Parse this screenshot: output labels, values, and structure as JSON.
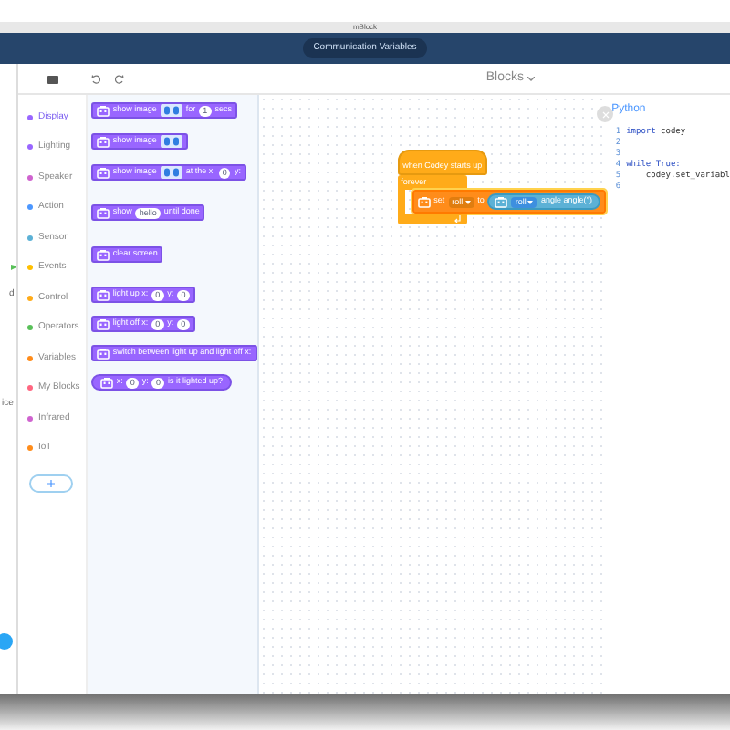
{
  "window": {
    "title": "mBlock",
    "tab": "Communication Variables"
  },
  "left_panel": {
    "texts": [
      "d",
      "ice"
    ]
  },
  "toolbar": {
    "mode": "Blocks"
  },
  "categories": [
    {
      "label": "Display",
      "color": "#9966ff",
      "selected": true
    },
    {
      "label": "Lighting",
      "color": "#9966ff",
      "selected": false
    },
    {
      "label": "Speaker",
      "color": "#cf63cf",
      "selected": false
    },
    {
      "label": "Action",
      "color": "#4c97ff",
      "selected": false
    },
    {
      "label": "Sensor",
      "color": "#5cb1d6",
      "selected": false
    },
    {
      "label": "Events",
      "color": "#ffbf00",
      "selected": false
    },
    {
      "label": "Control",
      "color": "#ffab19",
      "selected": false
    },
    {
      "label": "Operators",
      "color": "#59c059",
      "selected": false
    },
    {
      "label": "Variables",
      "color": "#ff8c1a",
      "selected": false
    },
    {
      "label": "My Blocks",
      "color": "#ff6680",
      "selected": false
    },
    {
      "label": "Infrared",
      "color": "#cf63cf",
      "selected": false
    },
    {
      "label": "IoT",
      "color": "#ff8c1a",
      "selected": false
    }
  ],
  "palette": [
    {
      "kind": "stack",
      "parts": [
        {
          "kind": "icon"
        },
        {
          "kind": "text",
          "text": "show image"
        },
        {
          "kind": "face"
        },
        {
          "kind": "text",
          "text": "for"
        },
        {
          "kind": "input",
          "text": "1"
        },
        {
          "kind": "text",
          "text": "secs"
        }
      ]
    },
    {
      "kind": "stack",
      "parts": [
        {
          "kind": "icon"
        },
        {
          "kind": "text",
          "text": "show image"
        },
        {
          "kind": "face"
        }
      ]
    },
    {
      "kind": "stack",
      "parts": [
        {
          "kind": "icon"
        },
        {
          "kind": "text",
          "text": "show image"
        },
        {
          "kind": "face"
        },
        {
          "kind": "text",
          "text": "at the x:"
        },
        {
          "kind": "input",
          "text": "0"
        },
        {
          "kind": "text",
          "text": "y:"
        }
      ]
    },
    {
      "kind": "stack",
      "parts": [
        {
          "kind": "icon"
        },
        {
          "kind": "text",
          "text": "show"
        },
        {
          "kind": "input",
          "text": "hello"
        },
        {
          "kind": "text",
          "text": "until done"
        }
      ]
    },
    {
      "kind": "stack",
      "parts": [
        {
          "kind": "icon"
        },
        {
          "kind": "text",
          "text": "clear screen"
        }
      ]
    },
    {
      "kind": "stack",
      "parts": [
        {
          "kind": "icon"
        },
        {
          "kind": "text",
          "text": "light up x:"
        },
        {
          "kind": "input",
          "text": "0"
        },
        {
          "kind": "text",
          "text": "y:"
        },
        {
          "kind": "input",
          "text": "0"
        }
      ]
    },
    {
      "kind": "stack",
      "parts": [
        {
          "kind": "icon"
        },
        {
          "kind": "text",
          "text": "light off x:"
        },
        {
          "kind": "input",
          "text": "0"
        },
        {
          "kind": "text",
          "text": "y:"
        },
        {
          "kind": "input",
          "text": "0"
        }
      ]
    },
    {
      "kind": "stack",
      "parts": [
        {
          "kind": "icon"
        },
        {
          "kind": "text",
          "text": "switch between light up and light off x:"
        }
      ]
    },
    {
      "kind": "boolean",
      "parts": [
        {
          "kind": "icon"
        },
        {
          "kind": "text",
          "text": "x:"
        },
        {
          "kind": "input",
          "text": "0"
        },
        {
          "kind": "text",
          "text": "y:"
        },
        {
          "kind": "input",
          "text": "0"
        },
        {
          "kind": "text",
          "text": "is it lighted up?"
        }
      ]
    }
  ],
  "script": {
    "hat": "when Codey starts up",
    "loop": "forever",
    "statement": [
      {
        "kind": "icon"
      },
      {
        "kind": "text",
        "text": "set"
      },
      {
        "kind": "dropdown",
        "text": "roll"
      },
      {
        "kind": "text",
        "text": "to"
      },
      {
        "kind": "reporter",
        "parts": [
          {
            "kind": "icon"
          },
          {
            "kind": "dropdown",
            "text": "roll"
          },
          {
            "kind": "text",
            "text": "angle angle(°)"
          }
        ]
      }
    ]
  },
  "python": {
    "title": "Python",
    "lines": [
      {
        "number": "1",
        "tokens": [
          {
            "kind": "keyword",
            "text": "import"
          },
          {
            "kind": "plain",
            "text": " codey"
          }
        ]
      },
      {
        "number": "2"
      },
      {
        "number": "3"
      },
      {
        "number": "4",
        "tokens": [
          {
            "kind": "keyword",
            "text": "while True:"
          }
        ]
      },
      {
        "number": "5",
        "tokens": [
          {
            "kind": "plain",
            "text": "    codey.set_variabl"
          }
        ]
      },
      {
        "number": "6"
      }
    ]
  }
}
